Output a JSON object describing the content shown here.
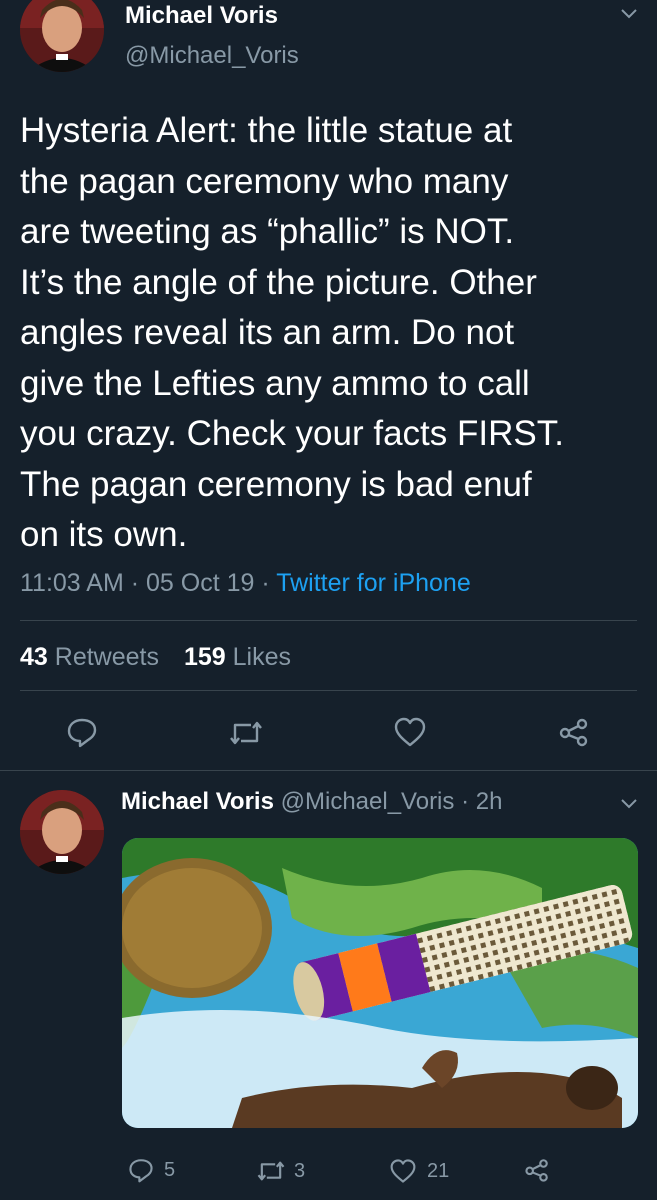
{
  "tweet": {
    "author_name": "Michael Voris",
    "author_handle": "@Michael_Voris",
    "text_lines": [
      "Hysteria Alert: the little statue at",
      "the pagan ceremony who many",
      "are tweeting as “phallic” is NOT.",
      "It’s the angle of the picture. Other",
      "angles reveal its an arm. Do not",
      "give the Lefties any ammo to call",
      "you crazy. Check your facts FIRST.",
      "The pagan ceremony is bad enuf",
      "on its own."
    ],
    "time": "11:03 AM",
    "date": "05 Oct 19",
    "source": "Twitter for iPhone",
    "sep": "·",
    "retweets_count": "43",
    "retweets_label": "Retweets",
    "likes_count": "159",
    "likes_label": "Likes"
  },
  "reply": {
    "author_name": "Michael Voris",
    "author_handle": "@Michael_Voris",
    "age": "· 2h",
    "replies": "5",
    "retweets": "3",
    "likes": "21"
  },
  "icons": {
    "reply": "reply-icon",
    "retweet": "retweet-icon",
    "like": "heart-icon",
    "share": "share-icon",
    "menu": "chevron-down-icon"
  },
  "colors": {
    "background": "#15202b",
    "muted": "#8899a6",
    "link": "#1da1f2",
    "divider": "#38444d"
  }
}
